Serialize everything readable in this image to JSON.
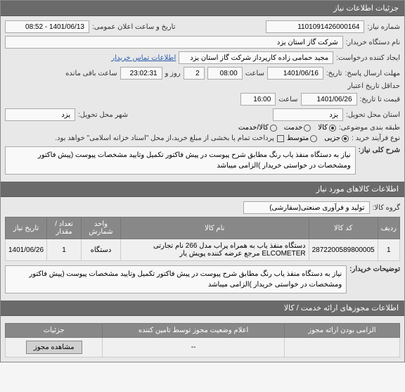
{
  "header1": "جزئیات اطلاعات نیاز",
  "form": {
    "need_no_label": "شماره نیاز:",
    "need_no": "1101091426000164",
    "announce_label": "تاریخ و ساعت اعلان عمومی:",
    "announce_value": "1401/06/13 - 08:52",
    "buyer_label": "نام دستگاه خریدار:",
    "buyer_value": "شرکت گاز استان یزد",
    "creator_label": "ایجاد کننده درخواست:",
    "creator_value": "مجید حمامی زاده کارپرداز شرکت گاز استان یزد",
    "contact_link": "اطلاعات تماس خریدار",
    "deadline_label": "مهلت ارسال پاسخ:",
    "date_label1": "تاریخ:",
    "deadline_date": "1401/06/16",
    "time_label1": "ساعت",
    "deadline_time": "08:00",
    "days_suffix": "روز و",
    "days_value": "2",
    "remaining": "23:02:31",
    "remaining_suffix": "ساعت باقی مانده",
    "min_validity_label": "حداقل تاریخ اعتبار",
    "price_to_label": "قیمت تا تاریخ:",
    "validity_date": "1401/06/26",
    "time_label2": "ساعت",
    "validity_time": "16:00",
    "need_loc_label": "استان محل تحویل:",
    "need_loc": "یزد",
    "deliver_city_label": "شهر محل تحویل:",
    "deliver_city": "یزد",
    "budget_label": "طبقه بندی موضوعی:",
    "rg_goods": "کالا",
    "rg_service": "خدمت",
    "rg_both": "کالا/خدمت",
    "buy_type_label": "نوع فرآیند خرید :",
    "bt_partial": "جزیی",
    "bt_medium": "متوسط",
    "bt_note": "پرداخت تمام یا بخشی از مبلغ خرید،از محل \"اسناد خزانه اسلامی\" خواهد بود."
  },
  "desc_header_label": "شرح کلی نیاز:",
  "desc_text": "نیاز به دستگاه منفذ یاب رنگ مطابق شرح پیوست در پیش فاکتور تکمیل وتایید مشخصات پیوست (پیش فاکتور ومشخصات در خواستی خریدار )الزامی میباشد",
  "header2": "اطلاعات کالاهای مورد نیاز",
  "group_label": "گروه کالا:",
  "group_value": "تولید و فرآوری صنعتی(سفارشی)",
  "table": {
    "headers": [
      "ردیف",
      "کد کالا",
      "نام کالا",
      "واحد شمارش",
      "تعداد / مقدار",
      "تاریخ نیاز"
    ],
    "rows": [
      {
        "idx": "1",
        "code": "2872200589800005",
        "name": "دستگاه منفذ یاب به همراه پراب مدل 266 نام تجارتی ELCOMETER مرجع عرضه کننده پویش یار",
        "unit": "دستگاه",
        "qty": "1",
        "date": "1401/06/26"
      }
    ]
  },
  "buyer_notes_label": "توضیحات خریدار:",
  "buyer_notes": "نیاز به دستگاه منفذ یاب رنگ مطابق شرح پیوست در پیش فاکتور تکمیل وتایید مشخصات پیوست (پیش فاکتور ومشخصات در خواستی خریدار )الزامی میباشد",
  "header3": "اطلاعات مجوزهای ارائه خدمت / کالا",
  "auth_table": {
    "headers": [
      "الزامی بودن ارائه مجوز",
      "اعلام وضعیت مجوز توسط تامین کننده",
      "جزئیات"
    ],
    "row": {
      "required": "",
      "status": "--",
      "details_btn": "مشاهده مجوز"
    }
  }
}
